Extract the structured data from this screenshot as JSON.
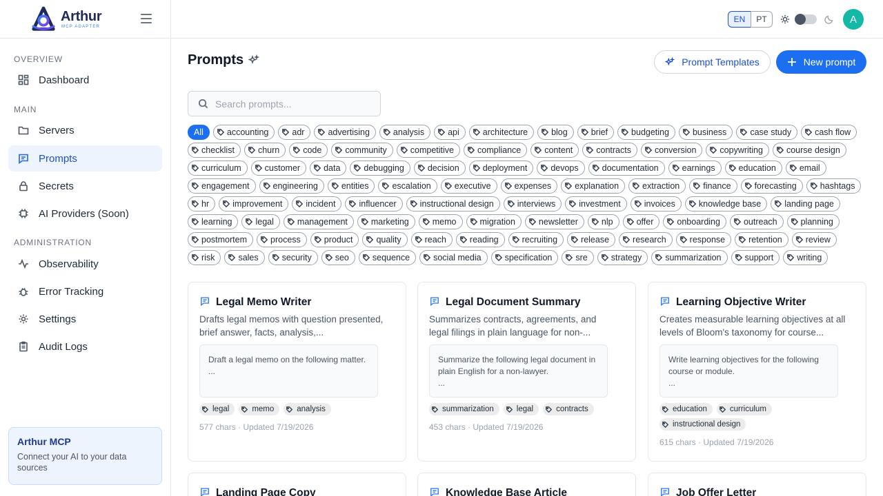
{
  "brand": {
    "name": "Arthur",
    "subtitle": "MCP ADAPTER"
  },
  "sidebar": {
    "sections": [
      "OVERVIEW",
      "MAIN",
      "ADMINISTRATION"
    ],
    "items": [
      {
        "label": "Dashboard",
        "icon": "dashboard-icon"
      },
      {
        "label": "Servers",
        "icon": "folder-icon"
      },
      {
        "label": "Prompts",
        "icon": "message-square-icon",
        "active": true
      },
      {
        "label": "Secrets",
        "icon": "lock-icon"
      },
      {
        "label": "AI Providers (Soon)",
        "icon": "cpu-icon"
      },
      {
        "label": "Observability",
        "icon": "activity-icon"
      },
      {
        "label": "Error Tracking",
        "icon": "bug-icon"
      },
      {
        "label": "Settings",
        "icon": "gear-icon"
      },
      {
        "label": "Audit Logs",
        "icon": "clipboard-icon"
      }
    ],
    "promo": {
      "title": "Arthur MCP",
      "text": "Connect your AI to your data sources"
    }
  },
  "header": {
    "languages": [
      "EN",
      "PT"
    ],
    "selected_language": "EN",
    "avatar_initial": "A",
    "theme": "light"
  },
  "main": {
    "title": "Prompts",
    "templates_button": "Prompt Templates",
    "new_button": "New prompt",
    "search_placeholder": "Search prompts...",
    "filter_all": "All",
    "tags": [
      "accounting",
      "adr",
      "advertising",
      "analysis",
      "api",
      "architecture",
      "blog",
      "brief",
      "budgeting",
      "business",
      "case study",
      "cash flow",
      "checklist",
      "churn",
      "code",
      "community",
      "competitive",
      "compliance",
      "content",
      "contracts",
      "conversion",
      "copywriting",
      "course design",
      "curriculum",
      "customer",
      "data",
      "debugging",
      "decision",
      "deployment",
      "devops",
      "documentation",
      "earnings",
      "education",
      "email",
      "engagement",
      "engineering",
      "entities",
      "escalation",
      "executive",
      "expenses",
      "explanation",
      "extraction",
      "finance",
      "forecasting",
      "hashtags",
      "hr",
      "improvement",
      "incident",
      "influencer",
      "instructional design",
      "interviews",
      "investment",
      "invoices",
      "knowledge base",
      "landing page",
      "learning",
      "legal",
      "management",
      "marketing",
      "memo",
      "migration",
      "newsletter",
      "nlp",
      "offer",
      "onboarding",
      "outreach",
      "planning",
      "postmortem",
      "process",
      "product",
      "quality",
      "reach",
      "reading",
      "recruiting",
      "release",
      "research",
      "response",
      "retention",
      "review",
      "risk",
      "sales",
      "security",
      "seo",
      "sequence",
      "social media",
      "specification",
      "sre",
      "strategy",
      "summarization",
      "support",
      "writing"
    ],
    "cards": [
      {
        "title": "Legal Memo Writer",
        "description": "Drafts legal memos with question presented, brief answer, facts, analysis,...",
        "preview_line1": "Draft a legal memo on the following matter.",
        "preview_more": "...",
        "tags": [
          "legal",
          "memo",
          "analysis"
        ],
        "meta": "577 chars · Updated 7/19/2026"
      },
      {
        "title": "Legal Document Summary",
        "description": "Summarizes contracts, agreements, and legal filings in plain language for non-...",
        "preview_line1": "Summarize the following legal document in plain English for a non-lawyer.",
        "preview_more": "...",
        "tags": [
          "summarization",
          "legal",
          "contracts"
        ],
        "meta": "453 chars · Updated 7/19/2026"
      },
      {
        "title": "Learning Objective Writer",
        "description": "Creates measurable learning objectives at all levels of Bloom's taxonomy for course...",
        "preview_line1": "Write learning objectives for the following course or module.",
        "preview_more": "...",
        "tags": [
          "education",
          "curriculum",
          "instructional design"
        ],
        "meta": "615 chars · Updated 7/19/2026"
      },
      {
        "title": "Landing Page Copy"
      },
      {
        "title": "Knowledge Base Article"
      },
      {
        "title": "Job Offer Letter"
      }
    ]
  }
}
